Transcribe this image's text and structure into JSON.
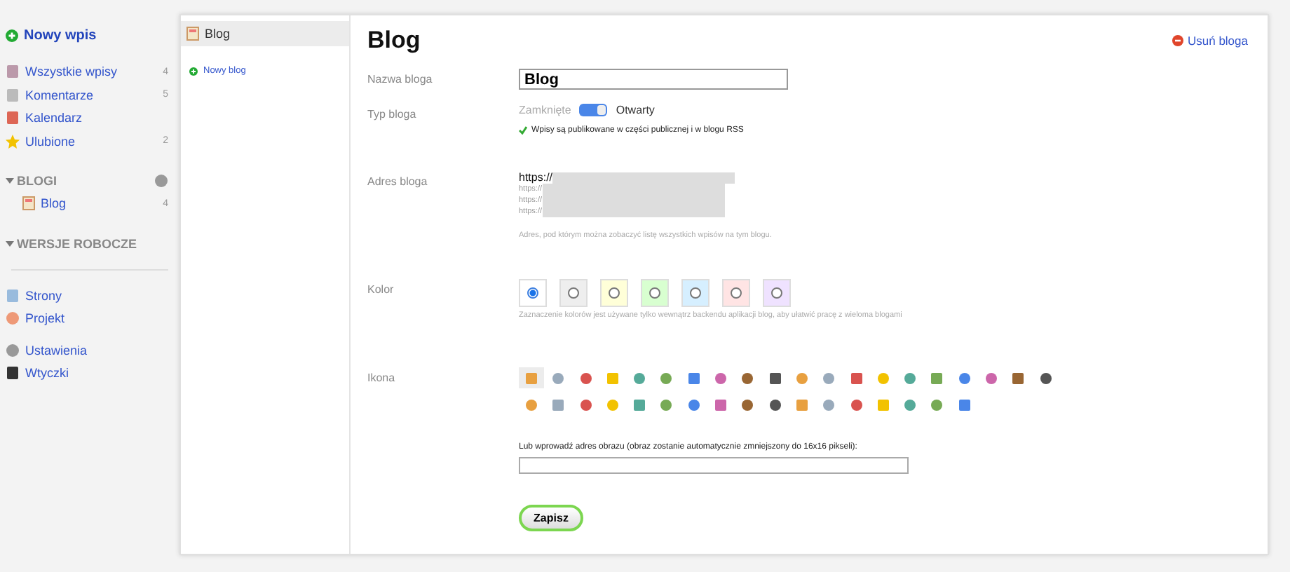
{
  "sidebar": {
    "new_post": "Nowy wpis",
    "items": [
      {
        "label": "Wszystkie wpisy",
        "count": "4"
      },
      {
        "label": "Komentarze",
        "count": "5"
      },
      {
        "label": "Kalendarz"
      },
      {
        "label": "Ulubione",
        "count": "2"
      }
    ],
    "blogs_heading": "BLOGI",
    "expanded": true,
    "blogs": [
      {
        "label": "Blog",
        "count": "4"
      }
    ],
    "drafts_heading": "WERSJE ROBOCZE",
    "bottom": [
      {
        "label": "Strony"
      },
      {
        "label": "Projekt"
      },
      {
        "label": "Ustawienia"
      },
      {
        "label": "Wtyczki"
      }
    ]
  },
  "blog_list": {
    "items": [
      {
        "label": "Blog",
        "selected": true
      }
    ],
    "new_blog": "Nowy blog"
  },
  "form": {
    "title": "Blog",
    "delete": "Usuń bloga",
    "name_label": "Nazwa bloga",
    "name_value": "Blog",
    "type_label": "Typ bloga",
    "type_off": "Zamknięte",
    "type_on": "Otwarty",
    "open": true,
    "type_note": "Wpisy są publikowane w części publicznej i w blogu RSS",
    "address_label": "Adres bloga",
    "address_main": "https://",
    "address_alts": [
      "https://",
      "https://",
      "https://"
    ],
    "address_hint": "Adres, pod którym można zobaczyć listę wszystkich wpisów na tym blogu.",
    "color_label": "Kolor",
    "colors": [
      {
        "color": "#ffffff",
        "selected": true
      },
      {
        "color": "#eeeeee",
        "selected": false
      },
      {
        "color": "#ffffd8",
        "selected": false
      },
      {
        "color": "#d8ffd0",
        "selected": false
      },
      {
        "color": "#d6efff",
        "selected": false
      },
      {
        "color": "#ffe4e4",
        "selected": false
      },
      {
        "color": "#efe2ff",
        "selected": false
      }
    ],
    "color_hint": "Zaznaczenie kolorów jest używane tylko wewnątrz backendu aplikacji blog, aby ułatwić pracę z wieloma blogami",
    "icon_label": "Ikona",
    "icons": [
      {
        "selected": true
      },
      {
        "selected": false
      },
      {
        "selected": false
      },
      {
        "selected": false
      },
      {
        "selected": false
      },
      {
        "selected": false
      },
      {
        "selected": false
      },
      {
        "selected": false
      },
      {
        "selected": false
      },
      {
        "selected": false
      },
      {
        "selected": false
      },
      {
        "selected": false
      },
      {
        "selected": false
      },
      {
        "selected": false
      },
      {
        "selected": false
      },
      {
        "selected": false
      },
      {
        "selected": false
      },
      {
        "selected": false
      },
      {
        "selected": false
      },
      {
        "selected": false
      },
      {
        "selected": false
      },
      {
        "selected": false
      },
      {
        "selected": false
      },
      {
        "selected": false
      },
      {
        "selected": false
      },
      {
        "selected": false
      },
      {
        "selected": false
      },
      {
        "selected": false
      },
      {
        "selected": false
      },
      {
        "selected": false
      },
      {
        "selected": false
      },
      {
        "selected": false
      },
      {
        "selected": false
      },
      {
        "selected": false
      },
      {
        "selected": false
      },
      {
        "selected": false
      },
      {
        "selected": false
      }
    ],
    "image_label": "Lub wprowadź adres obrazu (obraz zostanie automatycznie zmniejszony do 16x16 pikseli):",
    "save": "Zapisz"
  }
}
